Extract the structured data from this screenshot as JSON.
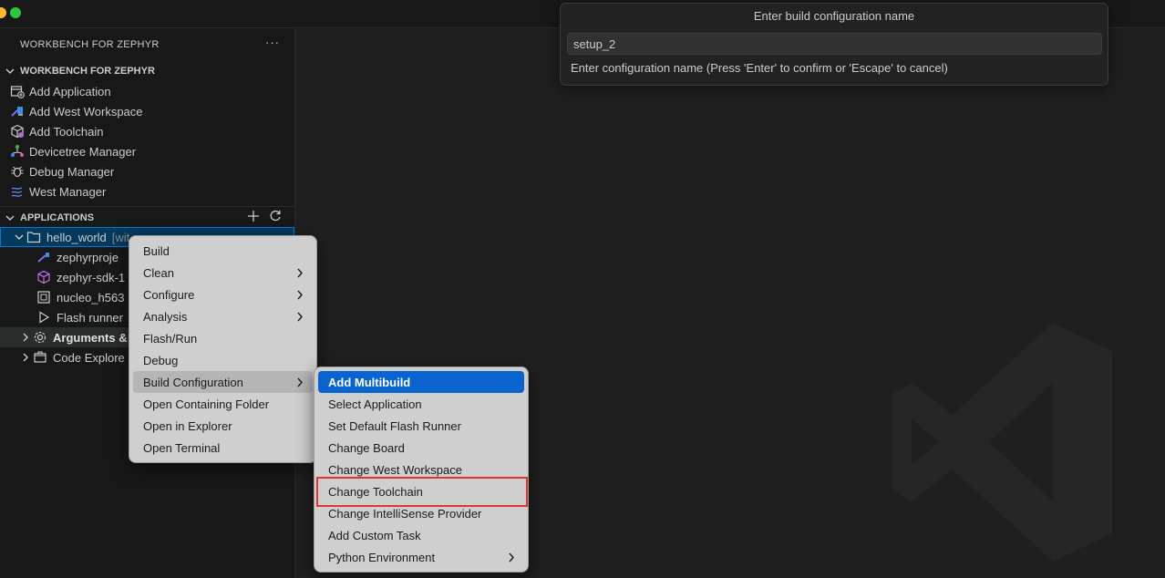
{
  "sidebar": {
    "header": "WORKBENCH FOR ZEPHYR",
    "more_label": "···",
    "section_workbench": {
      "title": "WORKBENCH FOR ZEPHYR",
      "items": [
        {
          "label": "Add Application",
          "icon": "add-app-icon"
        },
        {
          "label": "Add West Workspace",
          "icon": "west-workspace-icon"
        },
        {
          "label": "Add Toolchain",
          "icon": "toolchain-icon"
        },
        {
          "label": "Devicetree Manager",
          "icon": "devicetree-icon"
        },
        {
          "label": "Debug Manager",
          "icon": "bug-icon"
        },
        {
          "label": "West Manager",
          "icon": "west-icon"
        }
      ]
    },
    "section_applications": {
      "title": "APPLICATIONS",
      "project": {
        "label": "hello_world",
        "suffix": "[wit"
      },
      "children": [
        {
          "label": "zephyrproje",
          "icon": "west-link-icon"
        },
        {
          "label": "zephyr-sdk-1",
          "icon": "package-icon"
        },
        {
          "label": "nucleo_h563",
          "icon": "chip-icon"
        },
        {
          "label": "Flash runner",
          "icon": "play-icon"
        },
        {
          "label": "Arguments &",
          "icon": "gear-icon"
        },
        {
          "label": "Code Explore",
          "icon": "code-explorer-icon"
        }
      ]
    }
  },
  "quick_input": {
    "title": "Enter build configuration name",
    "value": "setup_2",
    "message": "Enter configuration name (Press 'Enter' to confirm or 'Escape' to cancel)"
  },
  "context_menu": {
    "items": [
      {
        "label": "Build",
        "submenu": false
      },
      {
        "label": "Clean",
        "submenu": true
      },
      {
        "label": "Configure",
        "submenu": true
      },
      {
        "label": "Analysis",
        "submenu": true
      },
      {
        "label": "Flash/Run",
        "submenu": false
      },
      {
        "label": "Debug",
        "submenu": false
      },
      {
        "label": "Build Configuration",
        "submenu": true
      },
      {
        "label": "Open Containing Folder",
        "submenu": false
      },
      {
        "label": "Open in Explorer",
        "submenu": false
      },
      {
        "label": "Open Terminal",
        "submenu": false
      }
    ]
  },
  "submenu": {
    "items": [
      {
        "label": "Add Multibuild"
      },
      {
        "label": "Select Application"
      },
      {
        "label": "Set Default Flash Runner"
      },
      {
        "label": "Change Board"
      },
      {
        "label": "Change West Workspace"
      },
      {
        "label": "Change Toolchain"
      },
      {
        "label": "Change IntelliSense Provider"
      },
      {
        "label": "Add Custom Task"
      },
      {
        "label": "Python Environment"
      }
    ]
  },
  "colors": {
    "accent": "#0a64d0",
    "highlight_box": "#d9383a",
    "selection_border": "#0078d4"
  }
}
